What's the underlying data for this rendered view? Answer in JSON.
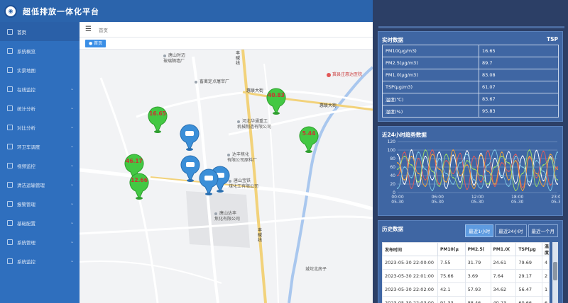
{
  "header": {
    "title": "超低排放一体化平台"
  },
  "sidebar": {
    "items": [
      {
        "label": "首页",
        "has_children": false
      },
      {
        "label": "系统概览",
        "has_children": false
      },
      {
        "label": "实景地图",
        "has_children": false
      },
      {
        "label": "在线监控",
        "has_children": true
      },
      {
        "label": "统计分析",
        "has_children": true
      },
      {
        "label": "对比分析",
        "has_children": true
      },
      {
        "label": "环卫车调度",
        "has_children": true
      },
      {
        "label": "视频监控",
        "has_children": true
      },
      {
        "label": "清洁运输管理",
        "has_children": true
      },
      {
        "label": "报警管理",
        "has_children": true
      },
      {
        "label": "基础配置",
        "has_children": true
      },
      {
        "label": "系统管理",
        "has_children": true
      },
      {
        "label": "系统监控",
        "has_children": true
      }
    ]
  },
  "content": {
    "breadcrumb": "首页",
    "tab": "首页"
  },
  "map": {
    "labels": [
      {
        "text": "唐山时迈\n玻璃隔墙厂"
      },
      {
        "text": "畜禽定点屠宰厂"
      },
      {
        "text": "河北华通重工\n机械制造有限公司"
      },
      {
        "text": "达丰焦化\n有限公司原料厂"
      },
      {
        "text": "唐山宝铁\n煤化工有限公司"
      },
      {
        "text": "唐山达丰\n焦化有限公司"
      },
      {
        "text": "城坨北房子"
      },
      {
        "text": "冀县庄惠达医院"
      }
    ],
    "roads": [
      "丰\n碱\n线",
      "惠联大街",
      "惠联大街",
      "丰\n碱\n线"
    ],
    "sensors": [
      "16.65",
      "40.83",
      "5.44",
      "46.17",
      "12.66"
    ]
  },
  "realtime": {
    "title": "实时数据",
    "right_label": "TSP",
    "rows": [
      {
        "name": "PM10(μg/m3)",
        "value": "16.65"
      },
      {
        "name": "PM2.5(μg/m3)",
        "value": "89.7"
      },
      {
        "name": "PM1.0(μg/m3)",
        "value": "83.08"
      },
      {
        "name": "TSP(μg/m3)",
        "value": "61.07"
      },
      {
        "name": "温度(℃)",
        "value": "83.67"
      },
      {
        "name": "湿度(%)",
        "value": "95.83"
      }
    ]
  },
  "trend": {
    "title": "近24小时趋势数据"
  },
  "chart_data": {
    "type": "line",
    "x": [
      "00:00\n05-30",
      "06:00\n05-30",
      "12:00\n05-30",
      "18:00\n05-30",
      "23:00\n05-30"
    ],
    "ylim": [
      0,
      120
    ],
    "yticks": [
      0,
      20,
      40,
      60,
      80,
      100,
      120
    ],
    "grid": true,
    "series_colors": [
      "#ffffff",
      "#e05c5c",
      "#f0a33c",
      "#7ec8e3",
      "#9ad86a"
    ],
    "series": [
      {
        "values": [
          90,
          20,
          100,
          15,
          85,
          30,
          95,
          10,
          88,
          25,
          98,
          18,
          92,
          12,
          80,
          35,
          96,
          22,
          86,
          16,
          99,
          28,
          84,
          20
        ]
      },
      {
        "values": [
          40,
          95,
          10,
          80,
          30,
          100,
          20,
          75,
          45,
          92,
          8,
          85,
          25,
          98,
          15,
          70,
          50,
          90,
          12,
          82,
          35,
          97,
          18,
          60
        ]
      },
      {
        "values": [
          70,
          30,
          85,
          45,
          15,
          90,
          55,
          25,
          100,
          40,
          65,
          10,
          88,
          50,
          20,
          95,
          30,
          75,
          5,
          85,
          45,
          15,
          90,
          55
        ]
      },
      {
        "values": [
          10,
          60,
          35,
          95,
          55,
          5,
          80,
          45,
          20,
          70,
          90,
          30,
          10,
          65,
          100,
          40,
          15,
          85,
          60,
          25,
          75,
          50,
          5,
          95
        ]
      },
      {
        "values": [
          55,
          85,
          65,
          25,
          100,
          50,
          15,
          90,
          35,
          10,
          75,
          55,
          40,
          20,
          60,
          85,
          70,
          5,
          45,
          100,
          15,
          65,
          80,
          30
        ]
      }
    ]
  },
  "history": {
    "title": "历史数据",
    "buttons": [
      "最近1小时",
      "最近24小时",
      "最近一个月"
    ],
    "columns": [
      "发布时间",
      "PM10(μ",
      "PM2.5(",
      "PM1.0(",
      "TSP(μg",
      "温度"
    ],
    "rows": [
      [
        "2023-05-30 22:00:00",
        "7.55",
        "31.79",
        "24.61",
        "79.69",
        "4"
      ],
      [
        "2023-05-30 22:01:00",
        "75.66",
        "3.69",
        "7.64",
        "29.17",
        "2"
      ],
      [
        "2023-05-30 22:02:00",
        "42.1",
        "57.93",
        "34.62",
        "56.47",
        "1"
      ],
      [
        "2023-05-30 22:03:00",
        "91.33",
        "88.46",
        "40.23",
        "60.66",
        "6"
      ]
    ]
  }
}
